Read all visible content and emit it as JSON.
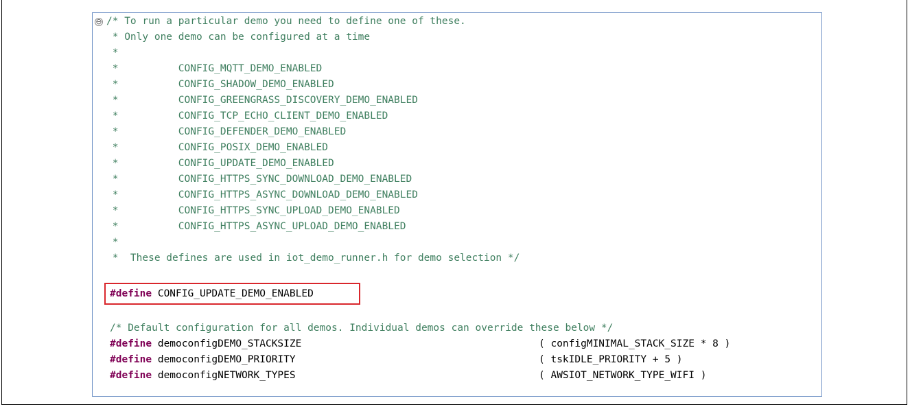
{
  "editor": {
    "fold_symbol": "⊖",
    "comment_block": [
      "/* To run a particular demo you need to define one of these.",
      " * Only one demo can be configured at a time",
      " *",
      " *          CONFIG_MQTT_DEMO_ENABLED",
      " *          CONFIG_SHADOW_DEMO_ENABLED",
      " *          CONFIG_GREENGRASS_DISCOVERY_DEMO_ENABLED",
      " *          CONFIG_TCP_ECHO_CLIENT_DEMO_ENABLED",
      " *          CONFIG_DEFENDER_DEMO_ENABLED",
      " *          CONFIG_POSIX_DEMO_ENABLED",
      " *          CONFIG_UPDATE_DEMO_ENABLED",
      " *          CONFIG_HTTPS_SYNC_DOWNLOAD_DEMO_ENABLED",
      " *          CONFIG_HTTPS_ASYNC_DOWNLOAD_DEMO_ENABLED",
      " *          CONFIG_HTTPS_SYNC_UPLOAD_DEMO_ENABLED",
      " *          CONFIG_HTTPS_ASYNC_UPLOAD_DEMO_ENABLED",
      " *",
      " *  These defines are used in iot_demo_runner.h for demo selection */"
    ],
    "highlighted_define": {
      "keyword": "#define",
      "name": " CONFIG_UPDATE_DEMO_ENABLED"
    },
    "default_comment": "/* Default configuration for all demos. Individual demos can override these below */",
    "defines": [
      {
        "keyword": "#define",
        "name": " democonfigDEMO_STACKSIZE",
        "value": "( configMINIMAL_STACK_SIZE * 8 )"
      },
      {
        "keyword": "#define",
        "name": " democonfigDEMO_PRIORITY",
        "value": "( tskIDLE_PRIORITY + 5 )"
      },
      {
        "keyword": "#define",
        "name": " democonfigNETWORK_TYPES",
        "value": "( AWSIOT_NETWORK_TYPE_WIFI )"
      }
    ]
  },
  "colors": {
    "comment": "#3f7f5f",
    "keyword": "#7f0055",
    "highlight_border": "#d9262c",
    "editor_border": "#6b8fc4"
  }
}
